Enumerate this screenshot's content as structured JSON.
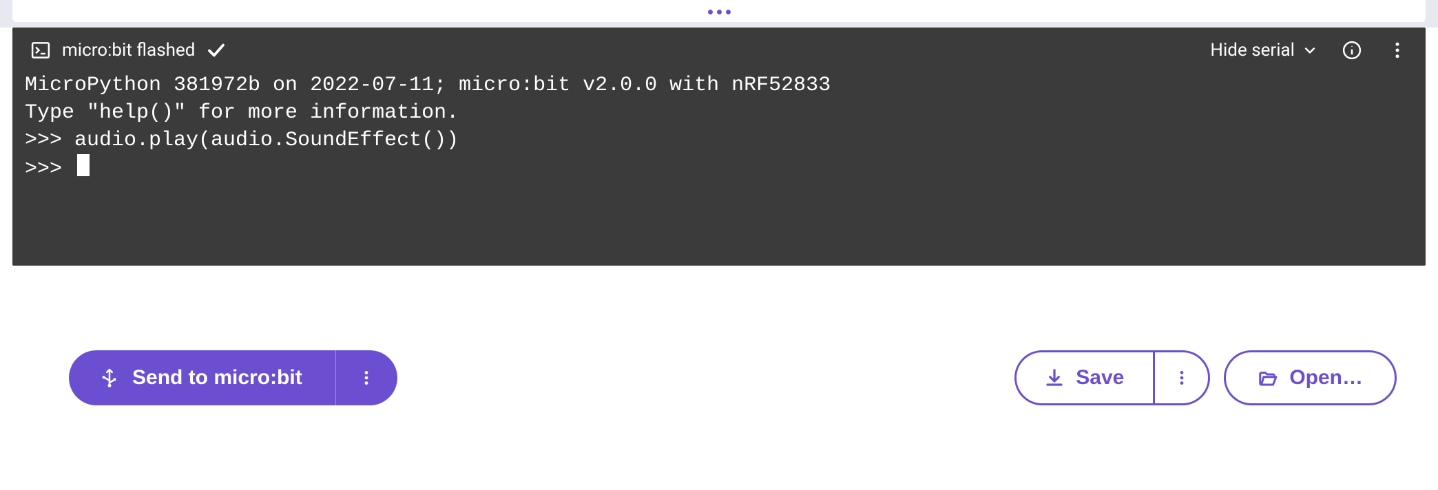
{
  "colors": {
    "accent": "#6c4fd1",
    "terminal_bg": "#3b3b3b",
    "terminal_fg": "#ffffff",
    "page_bg": "#ffffff",
    "strip_bg": "#e8e8f0"
  },
  "serial": {
    "status_label": "micro:bit flashed",
    "hide_label": "Hide serial",
    "lines": {
      "l0": "MicroPython 381972b on 2022-07-11; micro:bit v2.0.0 with nRF52833",
      "l1": "Type \"help()\" for more information.",
      "l2_prompt": ">>> ",
      "l2_cmd": "audio.play(audio.SoundEffect())",
      "l3_prompt": ">>> "
    }
  },
  "toolbar": {
    "send_label": "Send to micro:bit",
    "save_label": "Save",
    "open_label": "Open…"
  },
  "icons": {
    "terminal": "terminal-icon",
    "check": "check-icon",
    "chevron_down": "chevron-down-icon",
    "info": "info-icon",
    "kebab": "kebab-vertical-icon",
    "usb": "usb-icon",
    "download": "download-icon",
    "folder_open": "folder-open-icon"
  }
}
